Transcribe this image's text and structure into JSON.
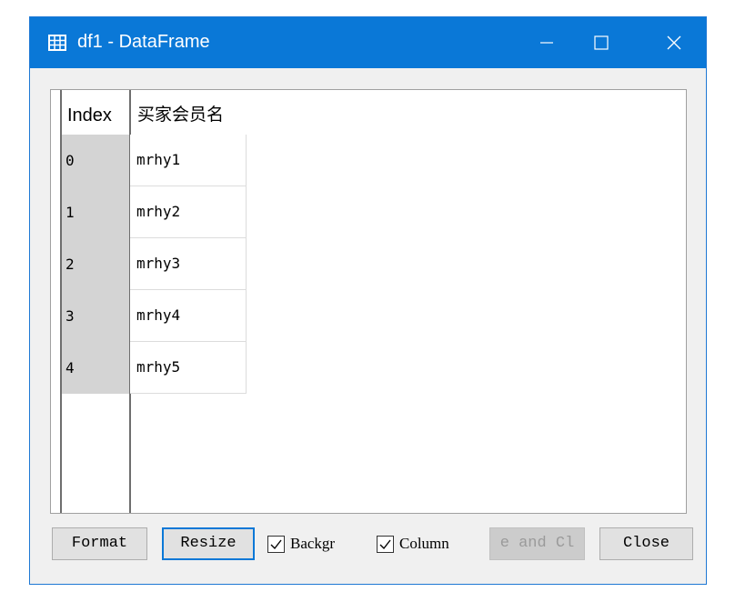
{
  "window": {
    "title": "df1 - DataFrame",
    "icon": "table-grid-icon",
    "accent_color": "#0a78d7"
  },
  "table": {
    "index_header": "Index",
    "column_header": "买家会员名",
    "rows": [
      {
        "index": "0",
        "value": "mrhy1"
      },
      {
        "index": "1",
        "value": "mrhy2"
      },
      {
        "index": "2",
        "value": "mrhy3"
      },
      {
        "index": "3",
        "value": "mrhy4"
      },
      {
        "index": "4",
        "value": "mrhy5"
      }
    ]
  },
  "buttons": {
    "format": "Format",
    "resize": "Resize",
    "save_close": "e and Cl",
    "close": "Close"
  },
  "checkboxes": {
    "background": {
      "label": "Backgr",
      "checked": true
    },
    "column": {
      "label": "Column",
      "checked": true
    }
  }
}
